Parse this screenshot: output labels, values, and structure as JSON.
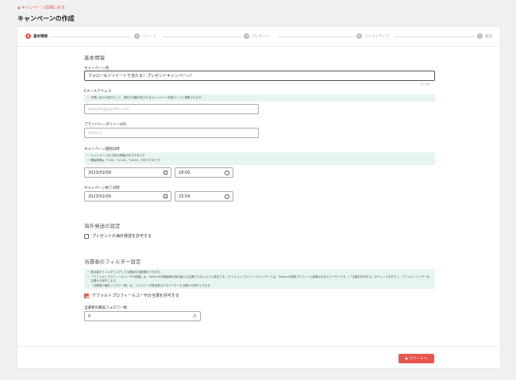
{
  "header": {
    "back_link": "キャンペーン詳細に戻る",
    "title": "キャンペーンの作成"
  },
  "stepper": [
    {
      "num": "1",
      "label": "基本情報"
    },
    {
      "num": "2",
      "label": "ツイート"
    },
    {
      "num": "3",
      "label": "プレゼント"
    },
    {
      "num": "4",
      "label": "クリエイティブ"
    },
    {
      "num": "5",
      "label": "確認"
    }
  ],
  "basic": {
    "section_title": "基本情報",
    "campaign_name_label": "キャンペーン名",
    "campaign_name_value": "フォロー&リツイートで当たる！プレゼントキャンペーン！",
    "campaign_name_counter": "27 / 50",
    "email_label": "Eメールアドレス",
    "email_info": "お問い合わせ窓口として、無料で自動作成されるキャンペーン特設ページに掲載されます。",
    "email_placeholder": "sample@pardot.com",
    "privacy_label": "プライバシーポリシーURL",
    "privacy_placeholder": "https://",
    "start_label": "キャンペーン開始日時",
    "start_info": [
      "キャンペーンは1日前の開催がおすすめです",
      "開始時間は「7:00」「12:00」「18:00」がおすすめです"
    ],
    "start_date": "2023/02/09",
    "start_time": "18:00",
    "end_label": "キャンペーン終了日時",
    "end_date": "2023/02/09",
    "end_time": "23:59"
  },
  "overseas": {
    "section_title": "海外発送の設定",
    "checkbox_label": "プレゼントの海外発送を許可する"
  },
  "filter": {
    "section_title": "当選者のフィルター設定",
    "info": [
      "懸当者をフィルタリングして当選者を自動選出できます。",
      "「デフォルトプロフィールユーザの抽選」は、Twitterの初期画像の懸当者には当選させないように設定です。(デフォルトプロフィールユーザーとは、Twitterの初期プロフィール画像のままのユーザーです。)「当選を許可する」のチェックを外すと、デフォルトユーザーを当選から除外します。",
      "「当選者の最低フォロワー数」は、フォロワーが設定数以下のユーザーを当選から除外できます。"
    ],
    "default_profile_label": "デフォルトプロフィールユーザの当選を許可する",
    "min_followers_label": "当選者の最低フォロワー数",
    "min_followers_value": "0",
    "min_followers_unit": "人"
  },
  "footer": {
    "next_label": "ツイートへ"
  },
  "colors": {
    "accent": "#e8574f",
    "info_bg": "#e8f5ee"
  }
}
